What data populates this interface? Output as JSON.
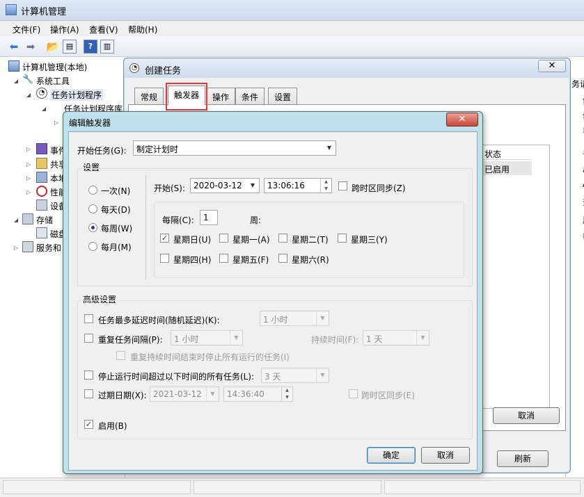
{
  "app": {
    "title": "计算机管理"
  },
  "menu": [
    "文件(F)",
    "操作(A)",
    "查看(V)",
    "帮助(H)"
  ],
  "tree": {
    "root": "计算机管理(本地)",
    "system_tools": "系统工具",
    "task_scheduler": "任务计划程序",
    "task_scheduler_lib": "任务计划程序库",
    "event_viewer": "事件",
    "shared": "共享",
    "local": "本地",
    "perf": "性能",
    "device": "设备",
    "storage": "存储",
    "disk": "磁盘",
    "services": "服务和"
  },
  "right_strip": [
    "务请",
    "创",
    "创",
    "导",
    "显",
    "启",
    "A",
    "查",
    "属",
    "帮"
  ],
  "create_task": {
    "title": "创建任务",
    "close": "✕",
    "tabs": [
      "常规",
      "触发器",
      "操作",
      "条件",
      "设置"
    ],
    "list_header": "状态",
    "list_row": "已启用",
    "cancel": "取消",
    "refresh": "刷新"
  },
  "edit_trigger": {
    "title": "编辑触发器",
    "close": "✕",
    "start_task_label": "开始任务(G):",
    "start_task_value": "制定计划时",
    "settings_label": "设置",
    "radios": [
      "一次(N)",
      "每天(D)",
      "每周(W)",
      "每月(M)"
    ],
    "start_label": "开始(S):",
    "start_date": "2020-03-12",
    "start_time": "13:06:16",
    "sync_tz": "跨时区同步(Z)",
    "every_label": "每隔(C):",
    "every_value": "1",
    "week_label": "周:",
    "days": [
      "星期日(U)",
      "星期一(A)",
      "星期二(T)",
      "星期三(Y)",
      "星期四(H)",
      "星期五(F)",
      "星期六(R)"
    ],
    "advanced_label": "高级设置",
    "delay_label": "任务最多延迟时间(随机延迟)(K):",
    "delay_value": "1 小时",
    "repeat_label": "重复任务间隔(P):",
    "repeat_value": "1 小时",
    "duration_label": "持续时间(F):",
    "duration_value": "1 天",
    "stop_at_end": "重复持续时间结束时停止所有运行的任务(I)",
    "stop_longer_label": "停止运行时间超过以下时间的所有任务(L):",
    "stop_longer_value": "3 天",
    "expire_label": "过期日期(X):",
    "expire_date": "2021-03-12",
    "expire_time": "14:36:40",
    "expire_sync": "跨时区同步(E)",
    "enabled": "启用(B)",
    "ok": "确定",
    "cancel": "取消"
  }
}
